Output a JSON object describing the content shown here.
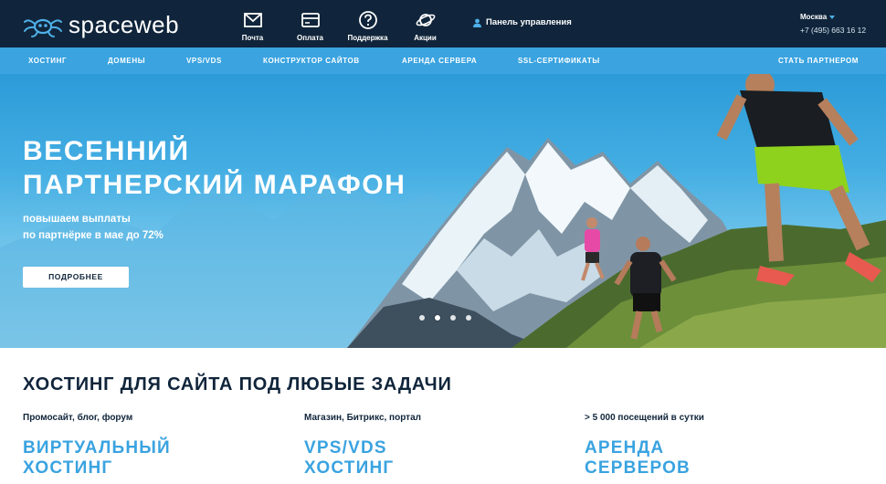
{
  "header": {
    "logo_text": "spaceweb",
    "icons": [
      {
        "label": "Почта",
        "icon": "mail-icon"
      },
      {
        "label": "Оплата",
        "icon": "card-icon"
      },
      {
        "label": "Поддержка",
        "icon": "help-icon"
      },
      {
        "label": "Акции",
        "icon": "planet-icon"
      }
    ],
    "panel_label": "Панель управления",
    "city": "Москва",
    "phone": "+7 (495) 663 16 12"
  },
  "nav": {
    "items": [
      "ХОСТИНГ",
      "ДОМЕНЫ",
      "VPS/VDS",
      "КОНСТРУКТОР САЙТОВ",
      "АРЕНДА СЕРВЕРА",
      "SSL-СЕРТИФИКАТЫ"
    ],
    "partner": "СТАТЬ ПАРТНЕРОМ"
  },
  "hero": {
    "title_line1": "ВЕСЕННИЙ",
    "title_line2": "ПАРТНЕРСКИЙ МАРАФОН",
    "subtitle_line1": "повышаем выплаты",
    "subtitle_line2": "по партнёрке в мае до 72%",
    "button": "ПОДРОБНЕЕ",
    "slides_count": 4,
    "active_slide": 2
  },
  "section": {
    "title": "ХОСТИНГ ДЛЯ САЙТА ПОД ЛЮБЫЕ ЗАДАЧИ",
    "columns": [
      {
        "caption": "Промосайт, блог, форум",
        "name_line1": "ВИРТУАЛЬНЫЙ",
        "name_line2": "ХОСТИНГ"
      },
      {
        "caption": "Магазин, Битрикс, портал",
        "name_line1": "VPS/VDS",
        "name_line2": "ХОСТИНГ"
      },
      {
        "caption": "> 5 000 посещений в сутки",
        "name_line1": "АРЕНДА",
        "name_line2": "СЕРВЕРОВ"
      }
    ]
  },
  "colors": {
    "header_bg": "#10253b",
    "nav_bg": "#3aa3e0",
    "accent": "#3aa3e0",
    "text_dark": "#10253b"
  }
}
